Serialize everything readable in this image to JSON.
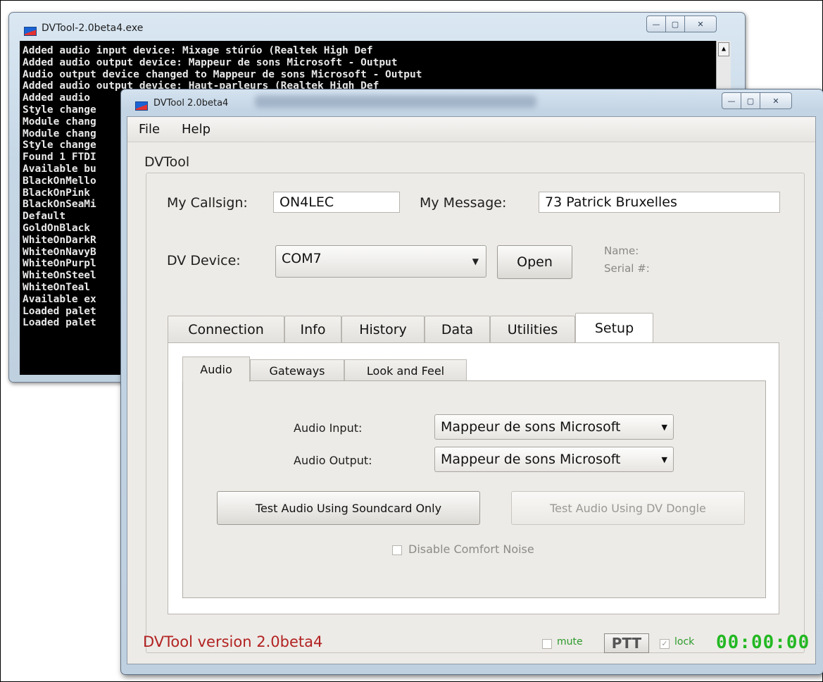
{
  "console": {
    "title": "DVTool-2.0beta4.exe",
    "lines": [
      "Added audio input device: Mixage stúrúo (Realtek High Def",
      "Added audio output device: Mappeur de sons Microsoft - Output",
      "Audio output device changed to Mappeur de sons Microsoft - Output",
      "Added audio output device: Haut-parleurs (Realtek High Def",
      "Added audio",
      "Style change",
      "Module chang",
      "Module chang",
      "Style change",
      "Found 1 FTDI",
      "Available bu",
      "BlackOnMello",
      "BlackOnPink",
      "BlackOnSeaMi",
      "Default",
      "GoldOnBlack",
      "WhiteOnDarkR",
      "WhiteOnNavyB",
      "WhiteOnPurpl",
      "WhiteOnSteel",
      "WhiteOnTeal",
      "Available ex",
      "Loaded palet",
      "Loaded palet"
    ],
    "scroll_up_glyph": "▲",
    "controls": {
      "minimize": "—",
      "maximize": "▢",
      "close": "✕"
    }
  },
  "main": {
    "title": "DVTool 2.0beta4",
    "controls": {
      "minimize": "—",
      "maximize": "▢",
      "close": "✕"
    },
    "menu": {
      "file": "File",
      "help": "Help"
    },
    "group_title": "DVTool",
    "callsign_label": "My Callsign:",
    "callsign_value": "ON4LEC",
    "message_label": "My Message:",
    "message_value": "73 Patrick Bruxelles",
    "device_label": "DV Device:",
    "device_value": "COM7",
    "open_button": "Open",
    "name_label": "Name:",
    "serial_label": "Serial #:",
    "tabs": [
      "Connection",
      "Info",
      "History",
      "Data",
      "Utilities",
      "Setup"
    ],
    "active_tab": "Setup",
    "subtabs": [
      "Audio",
      "Gateways",
      "Look and Feel"
    ],
    "active_subtab": "Audio",
    "audio": {
      "input_label": "Audio Input:",
      "input_value": "Mappeur de sons Microsoft",
      "output_label": "Audio Output:",
      "output_value": "Mappeur de sons Microsoft",
      "test_soundcard": "Test Audio Using Soundcard Only",
      "test_dongle": "Test Audio Using DV Dongle",
      "comfort_noise": "Disable Comfort Noise"
    },
    "status": {
      "version": "DVTool version 2.0beta4",
      "mute": "mute",
      "ptt": "PTT",
      "lock": "lock",
      "lock_check": "✓",
      "timer": "00:00:00"
    },
    "colors": {
      "version_text": "#b22222",
      "timer_green": "#23b823",
      "mute_green": "#2a9a2a"
    }
  }
}
